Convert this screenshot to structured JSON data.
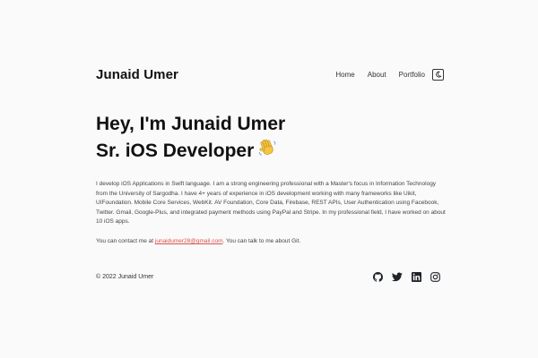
{
  "header": {
    "site_title": "Junaid Umer",
    "nav": {
      "home": "Home",
      "about": "About",
      "portfolio": "Portfolio"
    },
    "theme_toggle_icon": "moon-icon"
  },
  "hero": {
    "line1": "Hey, I'm Junaid Umer",
    "line2": "Sr. iOS Developer",
    "emoji_icon": "waving-hand-icon"
  },
  "bio": {
    "text": "I develop iOS Applications in Swift language. I am a strong engineering professional with a Master's focus in Information Technology from the University of Sargodha. I have 4+ years of experience in iOS development working with many frameworks like Uikit, UIFoundation. Mobile Core Services, WebKit. AV Foundation, Core Data, Firebase, REST APIs, User Authentication using Facebook, Twitter. Gmail, Google-Plus, and integrated payment methods using PayPal and Stripe. In my professional field, I have worked on about 10 iOS apps."
  },
  "contact": {
    "prefix": "You can contact me at ",
    "email": "junaidumer28@gmail.com",
    "suffix": ". You can talk to me about Git."
  },
  "footer": {
    "copyright": "© 2022 Junaid Umer",
    "social_icons": [
      "github-icon",
      "twitter-icon",
      "linkedin-icon",
      "instagram-icon"
    ]
  },
  "colors": {
    "background": "#fafafa",
    "text": "#111111",
    "link": "#d9534f"
  }
}
